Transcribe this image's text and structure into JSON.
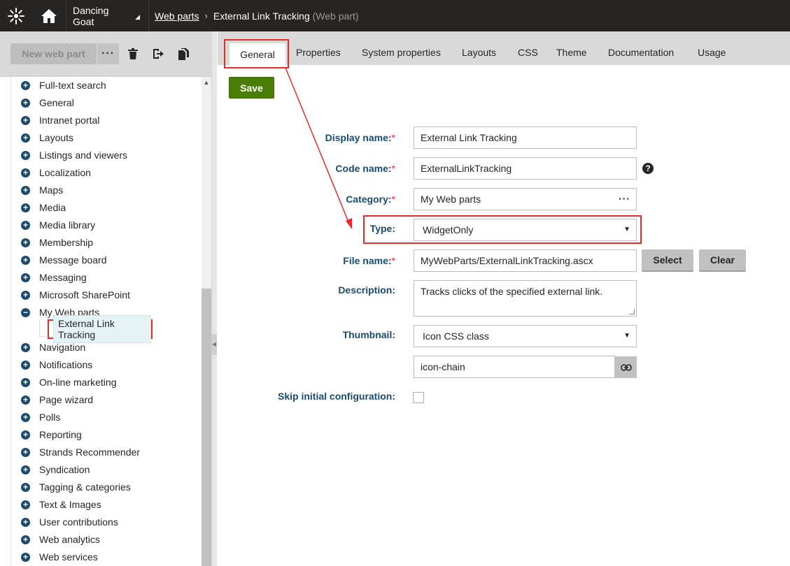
{
  "header": {
    "site_name": "Dancing Goat",
    "breadcrumb_link": "Web parts",
    "breadcrumb_current": "External Link Tracking",
    "breadcrumb_type": "(Web part)"
  },
  "left_toolbar": {
    "new_label": "New web part",
    "more_label": "···"
  },
  "tree": {
    "items": [
      {
        "label": "Full-text search"
      },
      {
        "label": "General"
      },
      {
        "label": "Intranet portal"
      },
      {
        "label": "Layouts"
      },
      {
        "label": "Listings and viewers"
      },
      {
        "label": "Localization"
      },
      {
        "label": "Maps"
      },
      {
        "label": "Media"
      },
      {
        "label": "Media library"
      },
      {
        "label": "Membership"
      },
      {
        "label": "Message board"
      },
      {
        "label": "Messaging"
      },
      {
        "label": "Microsoft SharePoint"
      },
      {
        "label": "My Web parts"
      },
      {
        "label": "Navigation"
      },
      {
        "label": "Notifications"
      },
      {
        "label": "On-line marketing"
      },
      {
        "label": "Page wizard"
      },
      {
        "label": "Polls"
      },
      {
        "label": "Reporting"
      },
      {
        "label": "Strands Recommender"
      },
      {
        "label": "Syndication"
      },
      {
        "label": "Tagging & categories"
      },
      {
        "label": "Text & Images"
      },
      {
        "label": "User contributions"
      },
      {
        "label": "Web analytics"
      },
      {
        "label": "Web services"
      }
    ],
    "selected_child": "External Link Tracking"
  },
  "tabs": {
    "general": "General",
    "properties": "Properties",
    "system_properties": "System properties",
    "layouts": "Layouts",
    "css": "CSS",
    "theme": "Theme",
    "documentation": "Documentation",
    "usage": "Usage"
  },
  "form": {
    "save_label": "Save",
    "display_name_label": "Display name:",
    "display_name_value": "External Link Tracking",
    "code_name_label": "Code name:",
    "code_name_value": "ExternalLinkTracking",
    "category_label": "Category:",
    "category_value": "My Web parts",
    "type_label": "Type:",
    "type_value": "WidgetOnly",
    "file_name_label": "File name:",
    "file_name_value": "MyWebParts/ExternalLinkTracking.ascx",
    "select_label": "Select",
    "clear_label": "Clear",
    "description_label": "Description:",
    "description_value": "Tracks clicks of the specified external link.",
    "thumbnail_label": "Thumbnail:",
    "thumbnail_value": "Icon CSS class",
    "icon_class_value": "icon-chain",
    "skip_label": "Skip initial configuration:",
    "required_mark": "*",
    "help_mark": "?"
  },
  "colors": {
    "header_bg": "#262524",
    "label_blue": "#1c4a6f",
    "save_green": "#497d04",
    "highlight_red": "#e32d2d",
    "toolbar_gray": "#d9d9d9"
  }
}
